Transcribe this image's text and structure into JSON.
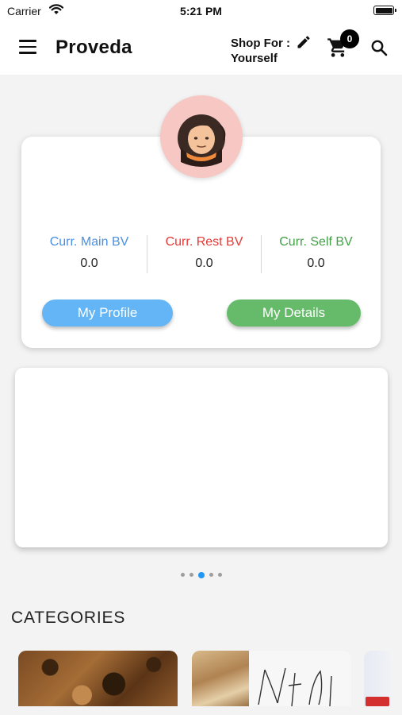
{
  "status_bar": {
    "carrier": "Carrier",
    "time": "5:21 PM"
  },
  "app_bar": {
    "title": "Proveda",
    "shop_for_label": "Shop For :",
    "shop_for_value": "Yourself",
    "cart_count": "0",
    "icons": [
      "menu-icon",
      "edit-icon",
      "cart-icon",
      "search-icon"
    ]
  },
  "profile_card": {
    "avatar_icon": "avatar-illustration",
    "stats": [
      {
        "label": "Curr. Main BV",
        "value": "0.0",
        "color": "#4a90e2"
      },
      {
        "label": "Curr. Rest BV",
        "value": "0.0",
        "color": "#e53935"
      },
      {
        "label": "Curr. Self BV",
        "value": "0.0",
        "color": "#43a047"
      }
    ],
    "buttons": {
      "my_profile": "My Profile",
      "my_details": "My Details"
    }
  },
  "banner": {
    "dot_count": 5,
    "active_index": 2
  },
  "categories": {
    "title": "CATEGORIES"
  },
  "colors": {
    "profile_button": "#64b5f6",
    "details_button": "#66bb6a",
    "avatar_bg": "#f7c7c4",
    "active_dot": "#2196f3"
  }
}
